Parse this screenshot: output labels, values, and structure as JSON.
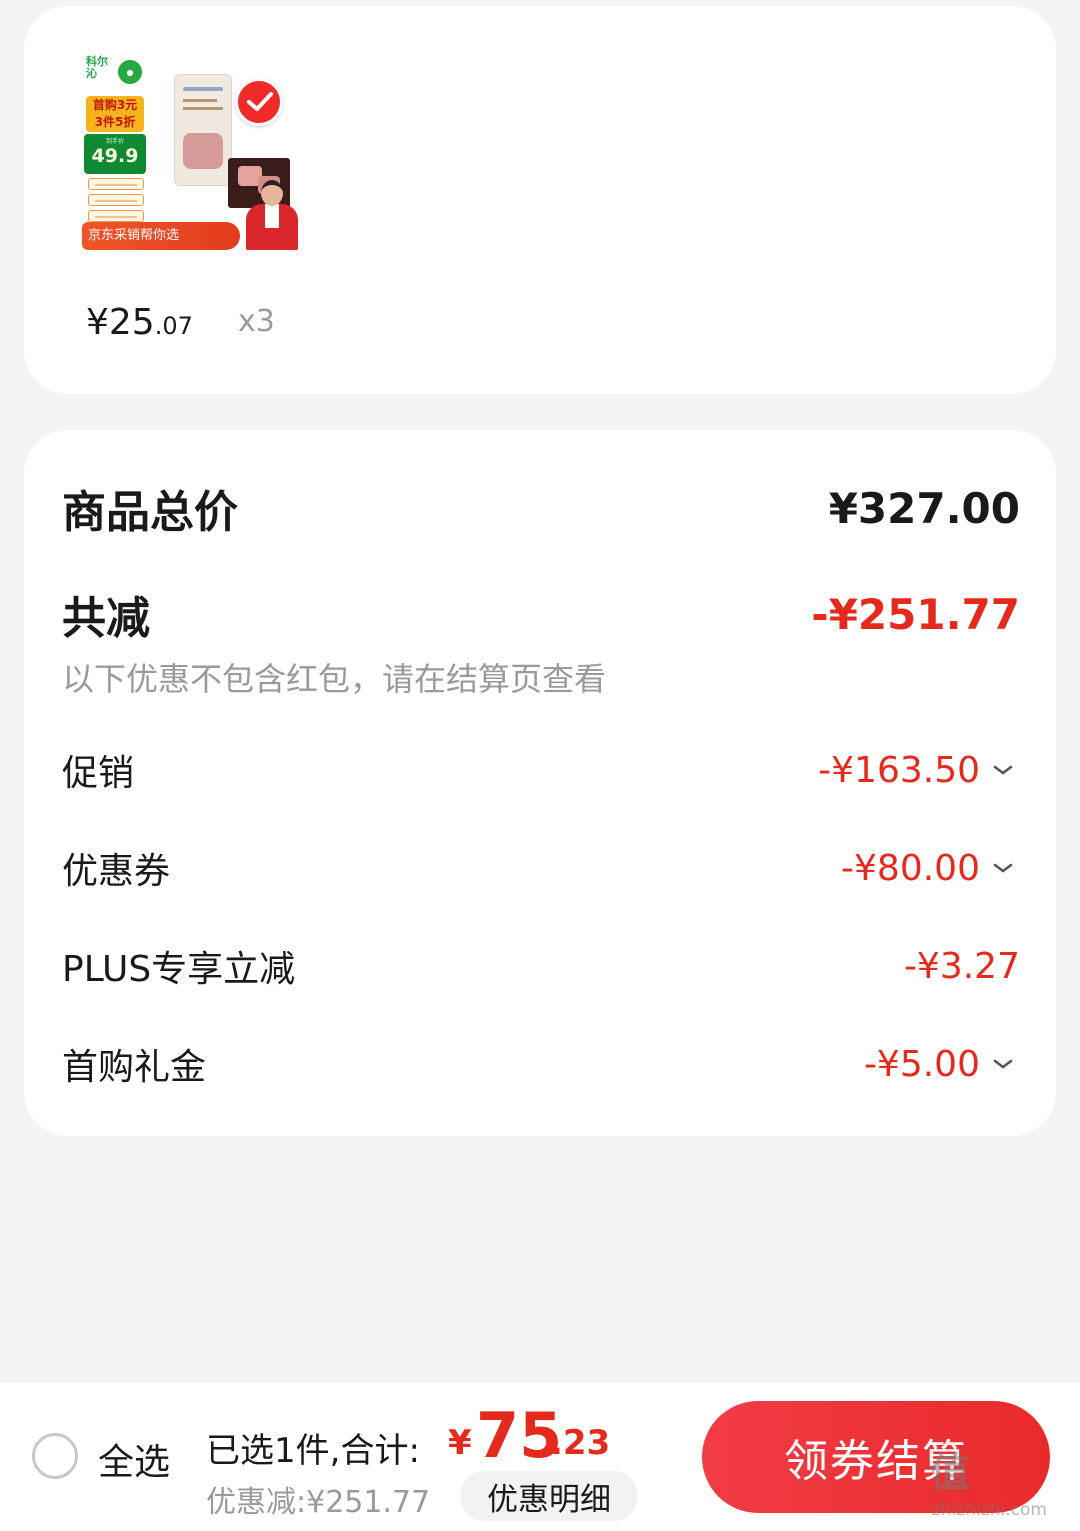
{
  "product": {
    "image": {
      "brand_logo_text": "科尔沁",
      "promo_line1": "首购3元",
      "promo_line2": "3件5折",
      "price_caption": "到手价",
      "price_value": "49.9",
      "banner_text": "京东采销帮你选"
    },
    "price_prefix": "¥25",
    "price_decimal": ".07",
    "quantity": "x3",
    "selected": true
  },
  "summary": {
    "total_label": "商品总价",
    "total_value": "¥327.00",
    "discount_label": "共减",
    "discount_value": "-¥251.77",
    "note": "以下优惠不包含红包，请在结算页查看",
    "items": [
      {
        "label": "促销",
        "value": "-¥163.50",
        "expandable": true
      },
      {
        "label": "优惠券",
        "value": "-¥80.00",
        "expandable": true
      },
      {
        "label": "PLUS专享立减",
        "value": "-¥3.27",
        "expandable": false
      },
      {
        "label": "首购礼金",
        "value": "-¥5.00",
        "expandable": true
      }
    ]
  },
  "bottom_bar": {
    "select_all_label": "全选",
    "selected_text": "已选1件,合计:",
    "total_yen": "¥",
    "total_integer": "75",
    "total_decimal": ".23",
    "saved_text": "优惠减:¥251.77",
    "detail_button": "优惠明细",
    "checkout_button": "领券结算"
  },
  "watermark": {
    "big": "值",
    "small": "zhizhizhi.com"
  },
  "colors": {
    "accent_red": "#e42a1d",
    "checkout_gradient_start": "#f23c46",
    "background": "#f4f4f4"
  }
}
